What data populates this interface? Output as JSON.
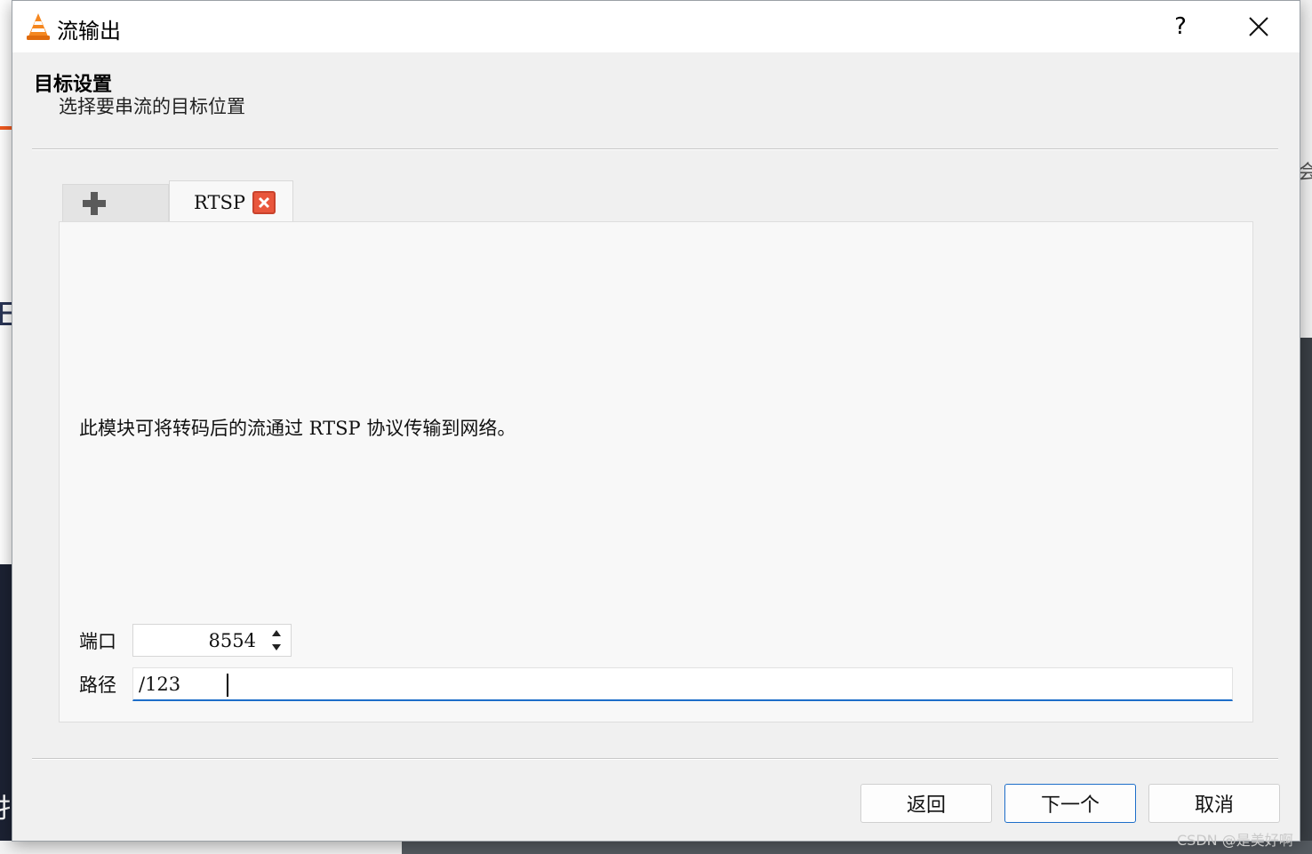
{
  "window": {
    "title": "流输出",
    "help_label": "?"
  },
  "page": {
    "heading": "目标设置",
    "subheading": "选择要串流的目标位置"
  },
  "tabs": {
    "add_icon": "plus-icon",
    "active_label": "RTSP",
    "close_icon": "close-tab-icon"
  },
  "module": {
    "description": "此模块可将转码后的流通过 RTSP 协议传输到网络。",
    "port_label": "端口",
    "port_value": "8554",
    "path_label": "路径",
    "path_value": "/123"
  },
  "buttons": {
    "back": "返回",
    "next": "下一个",
    "cancel": "取消"
  },
  "background": {
    "left_glyphs": [
      "",
      "E",
      "",
      "扌"
    ],
    "right_glyphs": [
      "",
      "会"
    ]
  },
  "watermark": "CSDN @是美好啊",
  "colors": {
    "accent": "#1d6ec9",
    "tab_close": "#e9563c",
    "vlc_orange": "#f5871f"
  }
}
